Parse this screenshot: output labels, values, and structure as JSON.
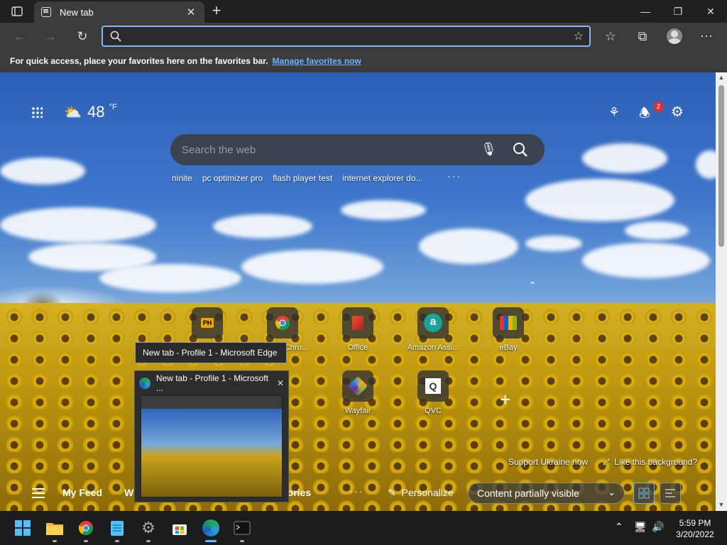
{
  "browser": {
    "tab": {
      "title": "New tab",
      "close": "✕"
    },
    "new_tab": "+",
    "window": {
      "minimize": "—",
      "maximize": "❐",
      "close": "✕"
    },
    "address": {
      "value": "",
      "placeholder": ""
    },
    "favorites_bar": {
      "message": "For quick access, place your favorites here on the favorites bar.",
      "link": "Manage favorites now"
    }
  },
  "ntp": {
    "weather": {
      "temperature": "48",
      "unit": "°F",
      "icon": "partly-cloudy-icon"
    },
    "notifications_count": "2",
    "search": {
      "placeholder": "Search the web"
    },
    "trending": [
      "ninite",
      "pc optimizer pro",
      "flash player test",
      "internet explorer do..."
    ],
    "quick_links": [
      {
        "name": "",
        "icon": "ph"
      },
      {
        "name": "Chro...",
        "icon": "chrome"
      },
      {
        "name": "Office",
        "icon": "office"
      },
      {
        "name": "Amazon Assi...",
        "icon": "amazon"
      },
      {
        "name": "eBay",
        "icon": "ebay"
      },
      {
        "name": "Wayfair",
        "icon": "wayfair"
      },
      {
        "name": "QVC",
        "icon": "qvc"
      }
    ],
    "support_link": "Support Ukraine now",
    "like_background": "Like this background?",
    "feed": {
      "my_feed": "My Feed",
      "tab2_partial": "W",
      "tab3_partial": "tories",
      "personalize": "Personalize",
      "content_visibility": "Content partially visible"
    }
  },
  "hover": {
    "tooltip": "New tab - Profile 1 - Microsoft Edge",
    "preview_title": "New tab - Profile 1 - Microsoft ..."
  },
  "taskbar": {
    "time": "5:59 PM",
    "date": "3/20/2022",
    "apps": [
      "start",
      "file-explorer",
      "chrome",
      "notepad",
      "settings",
      "store",
      "edge",
      "terminal"
    ],
    "accent": "#4cc2ff"
  }
}
